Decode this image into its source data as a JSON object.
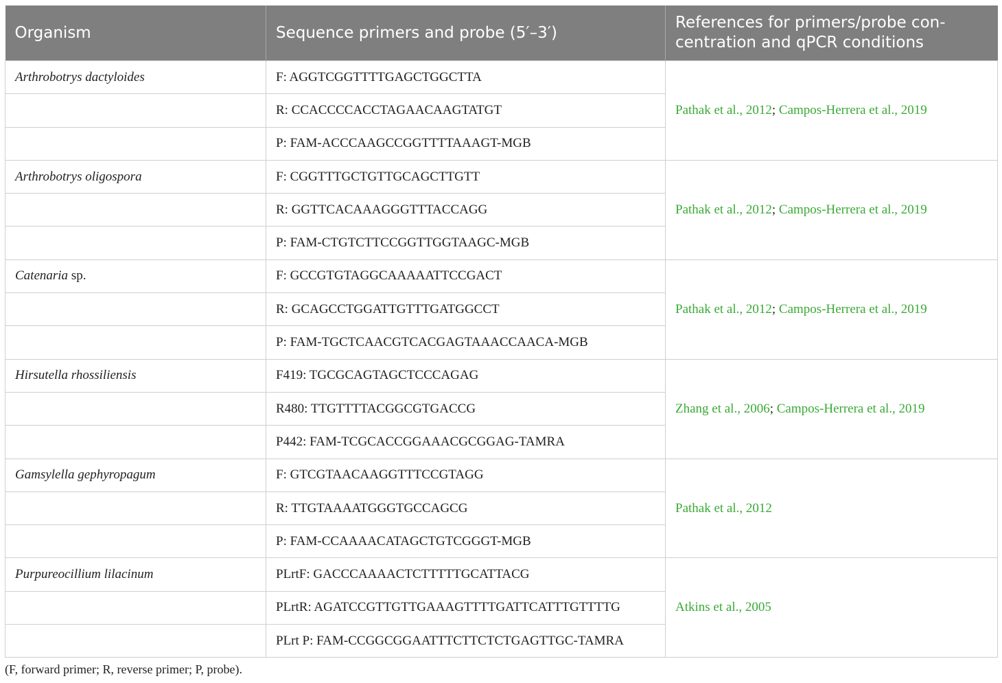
{
  "table": {
    "headers": [
      "Organism",
      "Sequence primers and probe (5′–3′)",
      "References for primers/probe con-centration and qPCR conditions"
    ],
    "groups": [
      {
        "organism": "Arthrobotrys dactyloides",
        "organism_suffix": "",
        "seqs": [
          "F: AGGTCGGTTTTGAGCTGGCTTA",
          "R: CCACCCCACCTAGAACAAGTATGT",
          "P: FAM-ACCCAAGCCGGTTTTAAAGT-MGB"
        ],
        "refs": [
          "Pathak et al., 2012",
          "Campos-Herrera et al., 2019"
        ]
      },
      {
        "organism": "Arthrobotrys oligospora",
        "organism_suffix": "",
        "seqs": [
          "F: CGGTTTGCTGTTGCAGCTTGTT",
          "R: GGTTCACAAAGGGTTTACCAGG",
          "P: FAM-CTGTCTTCCGGTTGGTAAGC-MGB"
        ],
        "refs": [
          "Pathak et al., 2012",
          "Campos-Herrera et al., 2019"
        ]
      },
      {
        "organism": "Catenaria",
        "organism_suffix": " sp.",
        "seqs": [
          "F: GCCGTGTAGGCAAAAATTCCGACT",
          "R: GCAGCCTGGATTGTTTGATGGCCT",
          "P: FAM-TGCTCAACGTCACGAGTAAACCAACA-MGB"
        ],
        "refs": [
          "Pathak et al., 2012",
          "Campos-Herrera et al., 2019"
        ]
      },
      {
        "organism": "Hirsutella rhossiliensis",
        "organism_suffix": "",
        "seqs": [
          "F419: TGCGCAGTAGCTCCCAGAG",
          "R480: TTGTTTTACGGCGTGACCG",
          "P442: FAM-TCGCACCGGAAACGCGGAG-TAMRA"
        ],
        "refs": [
          "Zhang et al., 2006",
          "Campos-Herrera et al., 2019"
        ]
      },
      {
        "organism": "Gamsylella gephyropagum",
        "organism_suffix": "",
        "seqs": [
          "F: GTCGTAACAAGGTTTCCGTAGG",
          "R: TTGTAAAATGGGTGCCAGCG",
          "P: FAM-CCAAAACATAGCTGTCGGGT-MGB"
        ],
        "refs": [
          "Pathak et al., 2012"
        ]
      },
      {
        "organism": "Purpureocillium lilacinum",
        "organism_suffix": "",
        "seqs": [
          "PLrtF: GACCCAAAACTCTTTTTGCATTACG",
          "PLrtR: AGATCCGTTGTTGAAAGTTTTGATTCATTTGTTTTG",
          "PLrt P: FAM-CCGGCGGAATTTCTTCTCTGAGTTGC-TAMRA"
        ],
        "refs": [
          "Atkins et al., 2005"
        ]
      }
    ]
  },
  "footnote": "(F, forward primer; R, reverse primer; P, probe).",
  "colors": {
    "header_bg": "#7f7f7f",
    "link": "#3aaa35"
  }
}
